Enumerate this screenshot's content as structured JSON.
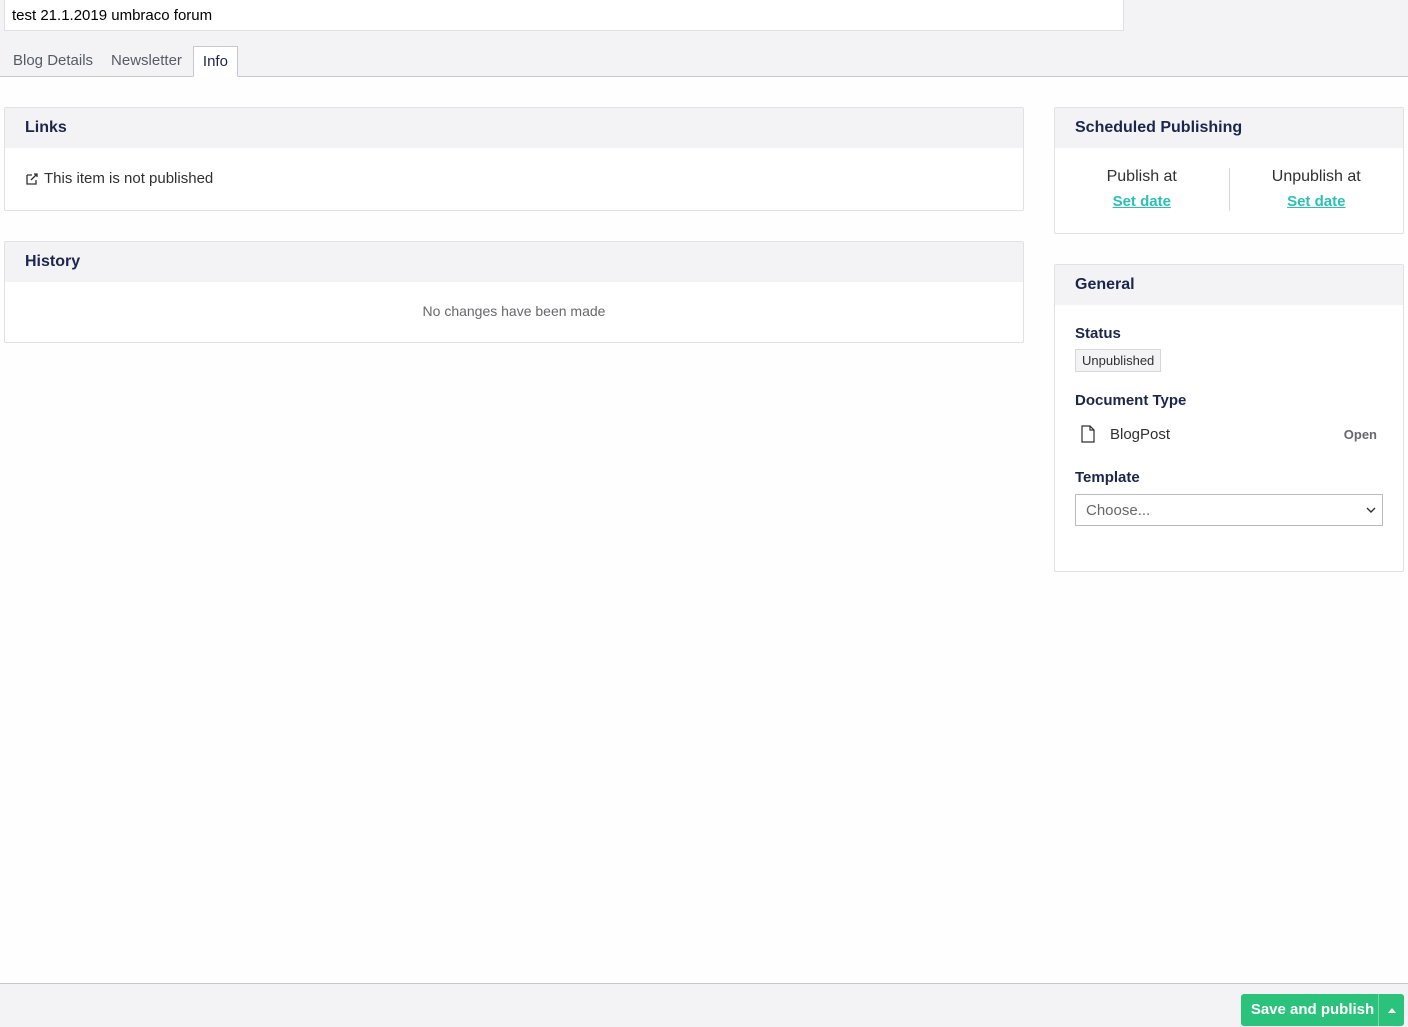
{
  "header": {
    "name_value": "test 21.1.2019 umbraco forum",
    "tabs": [
      {
        "label": "Blog Details"
      },
      {
        "label": "Newsletter"
      },
      {
        "label": "Info"
      }
    ]
  },
  "links": {
    "title": "Links",
    "message": "This item is not published"
  },
  "history": {
    "title": "History",
    "empty_message": "No changes have been made"
  },
  "scheduled": {
    "title": "Scheduled Publishing",
    "publish_label": "Publish at",
    "publish_link": "Set date",
    "unpublish_label": "Unpublish at",
    "unpublish_link": "Set date"
  },
  "general": {
    "title": "General",
    "status_label": "Status",
    "status_value": "Unpublished",
    "doctype_label": "Document Type",
    "doctype_name": "BlogPost",
    "doctype_open": "Open",
    "template_label": "Template",
    "template_value": "Choose..."
  },
  "footer": {
    "save_label": "Save and publish"
  },
  "colors": {
    "accent": "#2bc0b5",
    "save_button": "#2bc37c"
  }
}
